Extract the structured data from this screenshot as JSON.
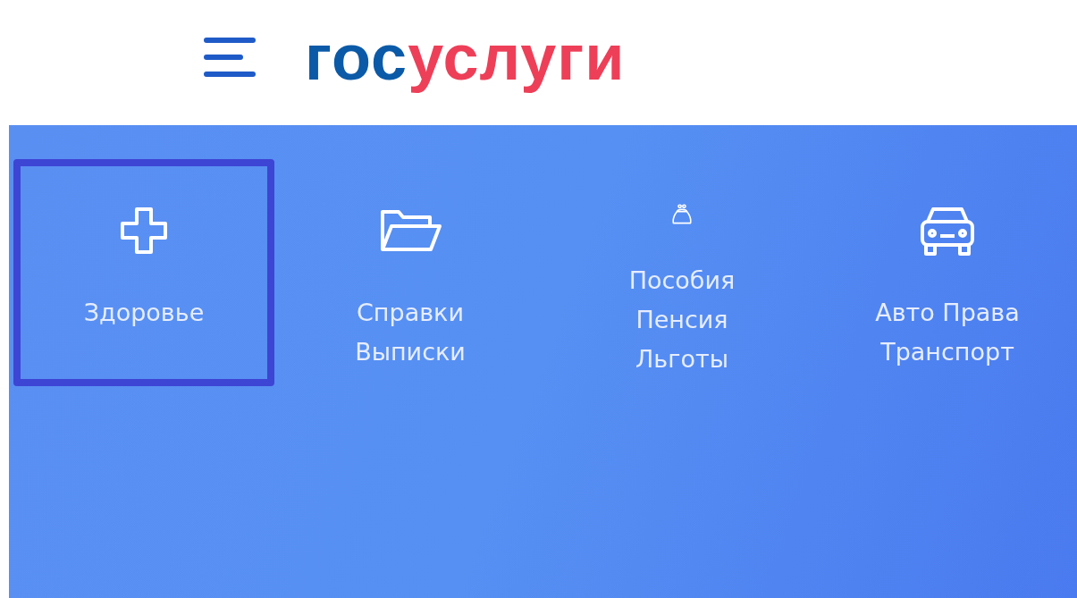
{
  "logo": {
    "part_1": "гос",
    "part_2": "услуги"
  },
  "categories": [
    {
      "kind": "health",
      "label": "Здоровье",
      "selected": true
    },
    {
      "kind": "documents",
      "label": "Справки Выписки",
      "selected": false
    },
    {
      "kind": "benefits",
      "label": "Пособия Пенсия Льготы",
      "selected": false
    },
    {
      "kind": "auto",
      "label": "Авто Права Транспорт",
      "selected": false
    }
  ]
}
